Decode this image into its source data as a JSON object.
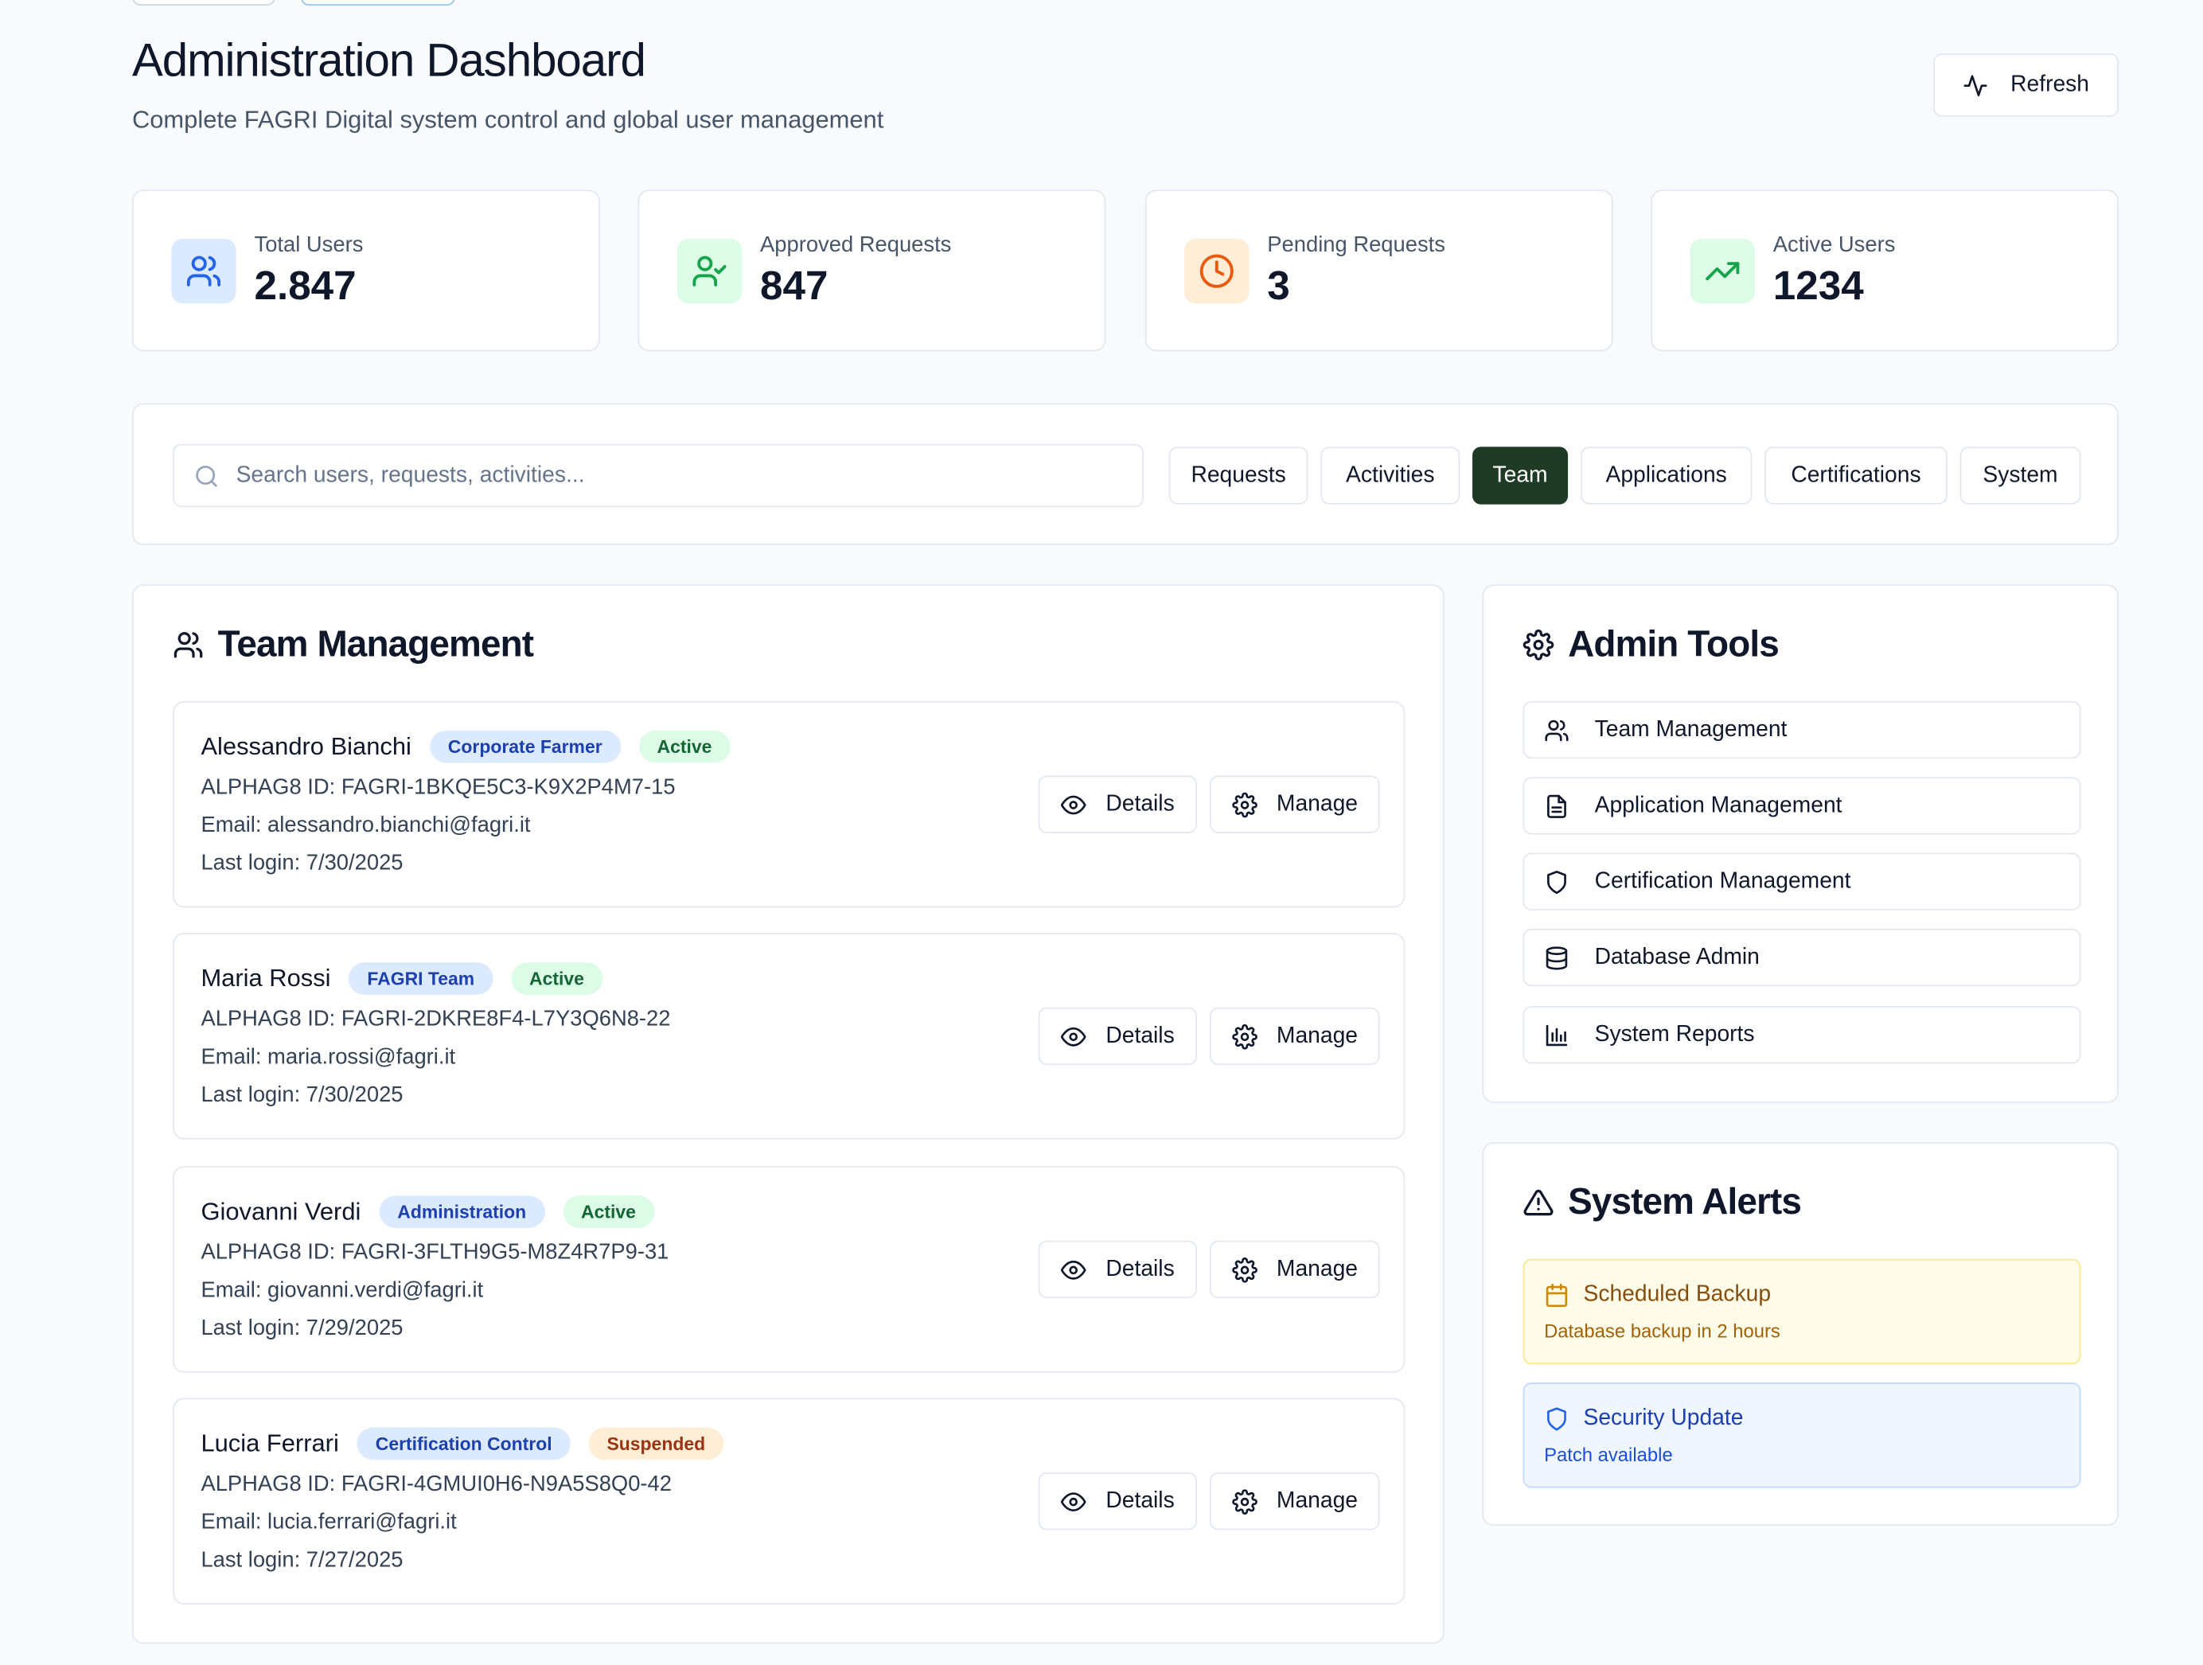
{
  "header": {
    "title": "Administration Dashboard",
    "subtitle": "Complete FAGRI Digital system control and global user management",
    "refresh_label": "Refresh"
  },
  "stats": [
    {
      "label": "Total Users",
      "value": "2.847",
      "icon": "users-icon",
      "color": "#2563eb"
    },
    {
      "label": "Approved Requests",
      "value": "847",
      "icon": "user-check-icon",
      "color": "#16a34a"
    },
    {
      "label": "Pending Requests",
      "value": "3",
      "icon": "clock-icon",
      "color": "#ea580c"
    },
    {
      "label": "Active Users",
      "value": "1234",
      "icon": "trending-up-icon",
      "color": "#16a34a"
    }
  ],
  "search": {
    "placeholder": "Search users, requests, activities..."
  },
  "tabs": [
    {
      "label": "Requests",
      "active": false
    },
    {
      "label": "Activities",
      "active": false
    },
    {
      "label": "Team",
      "active": true
    },
    {
      "label": "Applications",
      "active": false
    },
    {
      "label": "Certifications",
      "active": false
    },
    {
      "label": "System",
      "active": false
    }
  ],
  "team": {
    "title": "Team Management",
    "details_label": "Details",
    "manage_label": "Manage",
    "members": [
      {
        "name": "Alessandro Bianchi",
        "role": "Corporate Farmer",
        "status": "Active",
        "id_line": "ALPHAG8 ID: FAGRI-1BKQE5C3-K9X2P4M7-15",
        "email_line": "Email: alessandro.bianchi@fagri.it",
        "login_line": "Last login: 7/30/2025"
      },
      {
        "name": "Maria Rossi",
        "role": "FAGRI Team",
        "status": "Active",
        "id_line": "ALPHAG8 ID: FAGRI-2DKRE8F4-L7Y3Q6N8-22",
        "email_line": "Email: maria.rossi@fagri.it",
        "login_line": "Last login: 7/30/2025"
      },
      {
        "name": "Giovanni Verdi",
        "role": "Administration",
        "status": "Active",
        "id_line": "ALPHAG8 ID: FAGRI-3FLTH9G5-M8Z4R7P9-31",
        "email_line": "Email: giovanni.verdi@fagri.it",
        "login_line": "Last login: 7/29/2025"
      },
      {
        "name": "Lucia Ferrari",
        "role": "Certification Control",
        "status": "Suspended",
        "id_line": "ALPHAG8 ID: FAGRI-4GMUI0H6-N9A5S8Q0-42",
        "email_line": "Email: lucia.ferrari@fagri.it",
        "login_line": "Last login: 7/27/2025"
      }
    ]
  },
  "admin_tools": {
    "title": "Admin Tools",
    "items": [
      {
        "label": "Team Management",
        "icon": "users-icon"
      },
      {
        "label": "Application Management",
        "icon": "file-text-icon"
      },
      {
        "label": "Certification Management",
        "icon": "shield-icon"
      },
      {
        "label": "Database Admin",
        "icon": "database-icon"
      },
      {
        "label": "System Reports",
        "icon": "bar-chart-icon"
      }
    ]
  },
  "alerts": {
    "title": "System Alerts",
    "items": [
      {
        "title": "Scheduled Backup",
        "text": "Database backup in 2 hours",
        "icon": "calendar-icon",
        "color": "#ca8a04"
      },
      {
        "title": "Security Update",
        "text": "Patch available",
        "icon": "shield-icon",
        "color": "#2563eb"
      }
    ]
  }
}
